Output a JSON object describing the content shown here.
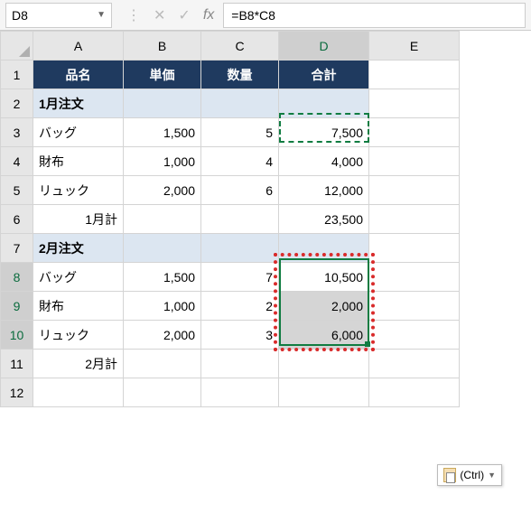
{
  "formula_bar": {
    "name_box": "D8",
    "formula": "=B8*C8"
  },
  "columns": [
    "A",
    "B",
    "C",
    "D",
    "E"
  ],
  "row_numbers": [
    "1",
    "2",
    "3",
    "4",
    "5",
    "6",
    "7",
    "8",
    "9",
    "10",
    "11",
    "12"
  ],
  "header_row": {
    "A": "品名",
    "B": "単価",
    "C": "数量",
    "D": "合計"
  },
  "rows": {
    "2": {
      "A": "1月注文"
    },
    "3": {
      "A": "バッグ",
      "B": "1,500",
      "C": "5",
      "D": "7,500"
    },
    "4": {
      "A": "財布",
      "B": "1,000",
      "C": "4",
      "D": "4,000"
    },
    "5": {
      "A": "リュック",
      "B": "2,000",
      "C": "6",
      "D": "12,000"
    },
    "6": {
      "A": "1月計",
      "D": "23,500"
    },
    "7": {
      "A": "2月注文"
    },
    "8": {
      "A": "バッグ",
      "B": "1,500",
      "C": "7",
      "D": "10,500"
    },
    "9": {
      "A": "財布",
      "B": "1,000",
      "C": "2",
      "D": "2,000"
    },
    "10": {
      "A": "リュック",
      "B": "2,000",
      "C": "3",
      "D": "6,000"
    },
    "11": {
      "A": "2月計"
    }
  },
  "paste_options": {
    "label": "(Ctrl)"
  },
  "active_cell": "D8",
  "selection": "D8:D10",
  "copied_range": "D3"
}
